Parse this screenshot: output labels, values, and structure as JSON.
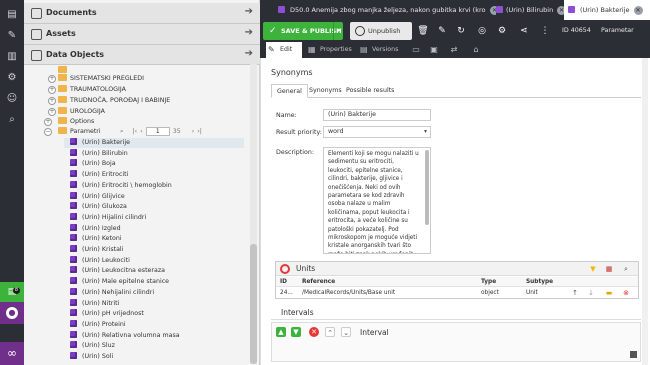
{
  "sidebar_accordion": [
    {
      "label": "Documents"
    },
    {
      "label": "Assets"
    },
    {
      "label": "Data Objects"
    }
  ],
  "tree_folders": [
    {
      "label": "SISTEMATSKI PREGLEDI"
    },
    {
      "label": "TRAUMATOLOGIJA"
    },
    {
      "label": "TRUDNOĆA, POROĐAJ I BABINJE"
    },
    {
      "label": "UROLOGIJA"
    }
  ],
  "tree_options": "Options",
  "tree_parametri": "Parametri",
  "tree_pager": {
    "page": "1",
    "total": "35"
  },
  "tree_items": [
    "(Urin) Bakterije",
    "(Urin) Bilirubin",
    "(Urin) Boja",
    "(Urin) Eritrociti",
    "(Urin) Eritrociti \\ hemoglobin",
    "(Urin) Glijvice",
    "(Urin) Glukoza",
    "(Urin) Hijalini cilindri",
    "(Urin) Izgled",
    "(Urin) Ketoni",
    "(Urin) Kristali",
    "(Urin) Leukociti",
    "(Urin) Leukocitna esteraza",
    "(Urin) Male epitelne stanice",
    "(Urin) Nehijalini cilindri",
    "(Urin) Nitriti",
    "(Urin) pH vrijednost",
    "(Urin) Proteini",
    "(Urin) Relativna volumna masa",
    "(Urin) Sluz",
    "(Urin) Soli"
  ],
  "leftbar": {
    "badge": "8"
  },
  "tabs": [
    {
      "label": "D50.0 Anemija zbog manjka željeza, nakon gubitka krvi (kroničnog)"
    },
    {
      "label": "(Urin) Bilirubin"
    },
    {
      "label": "(Urin) Bakterije"
    }
  ],
  "toolbar": {
    "save_label": "SAVE & PUBLISH",
    "unpublish_label": "Unpublish",
    "id_label": "ID 40654",
    "class_label": "Parametar"
  },
  "subtabs": [
    {
      "label": "Edit"
    },
    {
      "label": "Properties"
    },
    {
      "label": "Versions"
    }
  ],
  "form": {
    "section_title": "Synonyms",
    "tabs": [
      "General",
      "Synonyms",
      "Possible results"
    ],
    "name_label": "Name:",
    "name_value": "(Urin) Bakterije",
    "priority_label": "Result priority:",
    "priority_value": "word",
    "description_label": "Description:",
    "description_value": "Elementi koji se mogu nalaziti u sedimentu su eritrociti, leukociti, epitelne stanice, cilindri, bakterije, gljivice i onečišćenja. Neki od ovih parametara se kod zdravih osoba nalaze u malim količinama, poput leukocita i eritrocita, a veće količine su patološki pokazatelj. Pod mikroskopom je moguće vidjeti kristale anorganskih tvari što može biti znak nekih urođenih poremećaja metabolizma"
  },
  "units": {
    "title": "Units",
    "columns": [
      "ID",
      "Reference",
      "Type",
      "Subtype"
    ],
    "rows": [
      [
        "24...",
        "/MedicalRecords/Units/Base unit",
        "object",
        "Unit"
      ]
    ]
  },
  "intervals": {
    "title": "Intervals",
    "block_label": "Interval"
  },
  "colors": {
    "accent_green": "#3db33c",
    "accent_purple": "#702f8a",
    "dark_bg": "#2c2e36",
    "cube": "#7a3ec2"
  }
}
